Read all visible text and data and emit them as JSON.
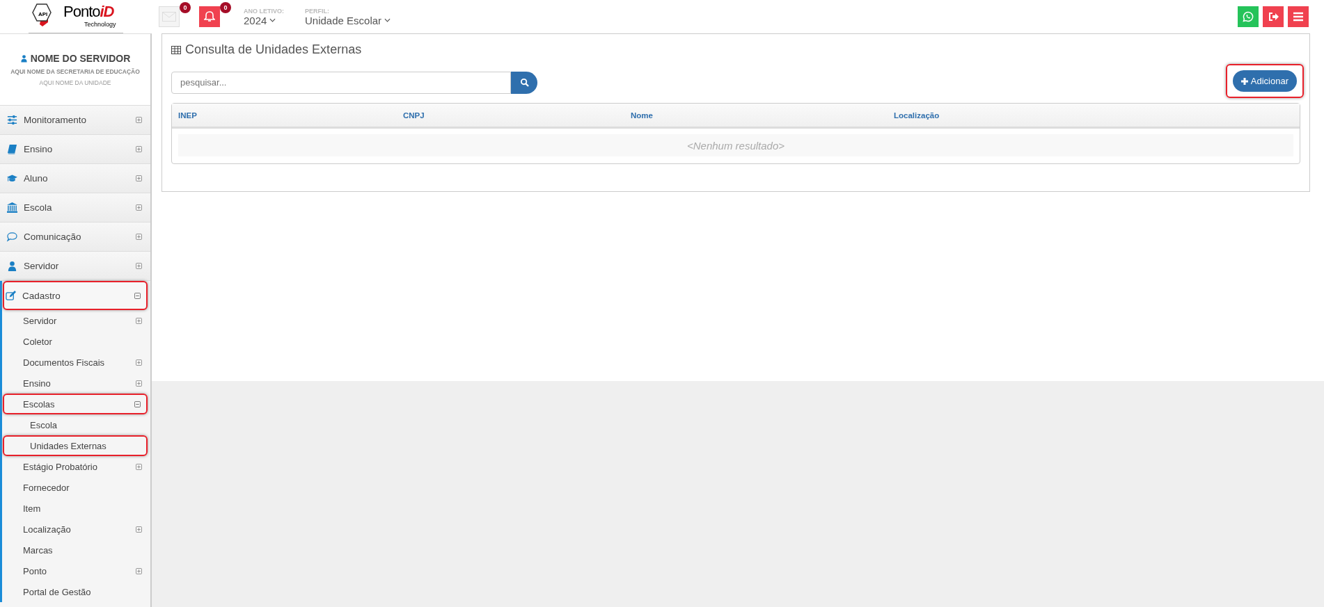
{
  "header": {
    "logo": {
      "badge": "API",
      "name": "Ponto",
      "name_accent": "iD",
      "tagline": "Technology"
    },
    "messages": {
      "count": "0"
    },
    "notifications": {
      "count": "0"
    },
    "year": {
      "label": "ANO LETIVO:",
      "value": "2024"
    },
    "profile": {
      "label": "PERFIL:",
      "value": "Unidade Escolar"
    },
    "actions": [
      {
        "kind": "whatsapp"
      },
      {
        "kind": "logout"
      },
      {
        "kind": "menu"
      }
    ]
  },
  "user": {
    "name": "NOME DO SERVIDOR",
    "department": "AQUI NOME DA SECRETARIA DE EDUCAÇÃO",
    "unit": "AQUI NOME DA UNIDADE"
  },
  "sidebar": {
    "items": [
      {
        "label": "Monitoramento",
        "kind": "sliders",
        "expanded": false,
        "highlighted": false
      },
      {
        "label": "Ensino",
        "kind": "book",
        "expanded": false,
        "highlighted": false
      },
      {
        "label": "Aluno",
        "kind": "graduation",
        "expanded": false,
        "highlighted": false
      },
      {
        "label": "Escola",
        "kind": "bank",
        "expanded": false,
        "highlighted": false
      },
      {
        "label": "Comunicação",
        "kind": "chat",
        "expanded": false,
        "highlighted": false
      },
      {
        "label": "Servidor",
        "kind": "user",
        "expanded": false,
        "highlighted": false
      },
      {
        "label": "Cadastro",
        "kind": "edit",
        "expanded": true,
        "highlighted": true,
        "children": [
          {
            "label": "Servidor",
            "kind": "group",
            "expanded": false,
            "highlighted": false
          },
          {
            "label": "Coletor",
            "kind": "link",
            "highlighted": false
          },
          {
            "label": "Documentos Fiscais",
            "kind": "group",
            "expanded": false,
            "highlighted": false
          },
          {
            "label": "Ensino",
            "kind": "group",
            "expanded": false,
            "highlighted": false
          },
          {
            "label": "Escolas",
            "kind": "group",
            "expanded": true,
            "highlighted": true,
            "children": [
              {
                "label": "Escola",
                "highlighted": false
              },
              {
                "label": "Unidades Externas",
                "highlighted": true
              }
            ]
          },
          {
            "label": "Estágio Probatório",
            "kind": "group",
            "expanded": false,
            "highlighted": false
          },
          {
            "label": "Fornecedor",
            "kind": "link",
            "highlighted": false
          },
          {
            "label": "Item",
            "kind": "link",
            "highlighted": false
          },
          {
            "label": "Localização",
            "kind": "group",
            "expanded": false,
            "highlighted": false
          },
          {
            "label": "Marcas",
            "kind": "link",
            "highlighted": false
          },
          {
            "label": "Ponto",
            "kind": "group",
            "expanded": false,
            "highlighted": false
          },
          {
            "label": "Portal de Gestão",
            "kind": "link",
            "highlighted": false
          }
        ]
      }
    ]
  },
  "main": {
    "title": "Consulta de Unidades Externas",
    "search": {
      "placeholder": "pesquisar..."
    },
    "add_button": {
      "label": "Adicionar",
      "highlighted": true
    },
    "table": {
      "columns": [
        "INEP",
        "CNPJ",
        "Nome",
        "Localização"
      ],
      "empty_message": "<Nenhum resultado>"
    }
  }
}
